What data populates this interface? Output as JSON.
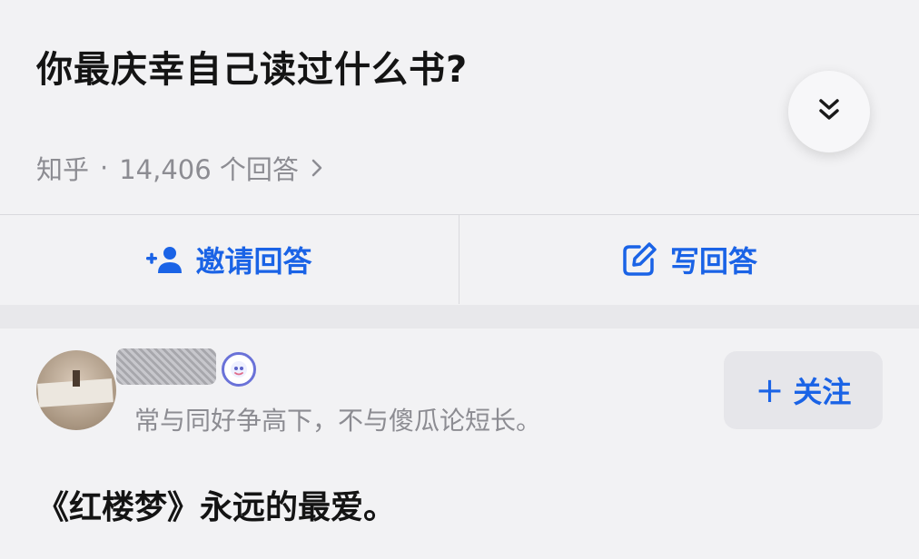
{
  "question": {
    "title": "你最庆幸自己读过什么书?",
    "source": "知乎",
    "separator": "·",
    "answer_count": "14,406 个回答",
    "chevron_icon": "chevron-right-icon",
    "collapse_icon": "double-chevron-down-icon"
  },
  "actions": {
    "invite_label": "邀请回答",
    "invite_icon": "add-person-icon",
    "write_label": "写回答",
    "write_icon": "edit-icon"
  },
  "answer": {
    "author_bio": "常与同好争高下，不与傻瓜论短长。",
    "follow_label": "关注",
    "follow_icon": "plus-icon",
    "content": "《红楼梦》永远的最爱。"
  },
  "colors": {
    "accent": "#1a63e6",
    "secondary_text": "#8c8c92",
    "background": "#f2f2f4"
  }
}
